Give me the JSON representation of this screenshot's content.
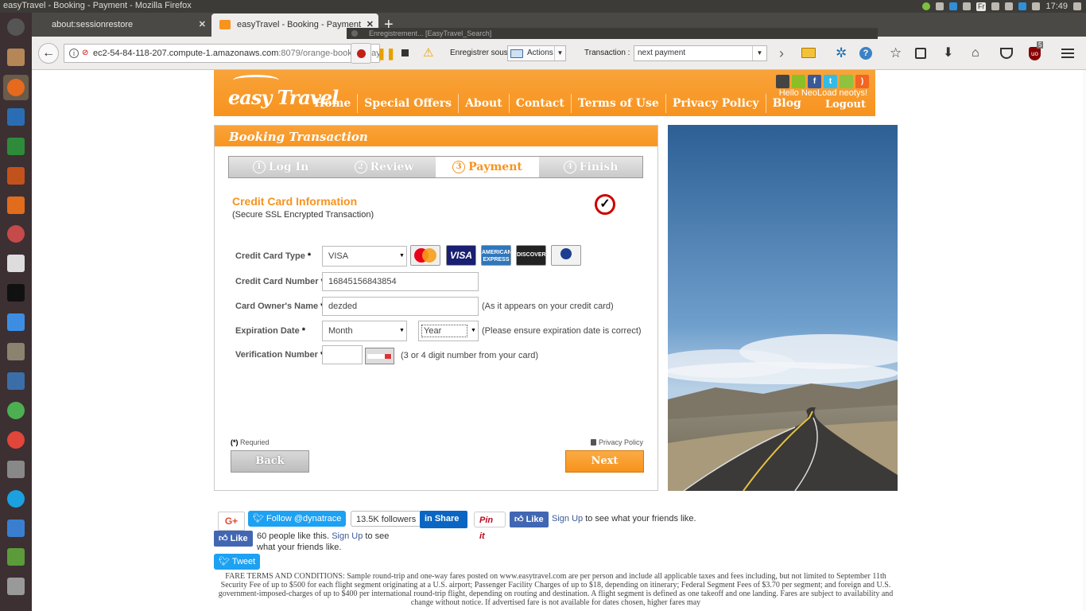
{
  "os_panel": {
    "window_title": "easyTravel - Booking - Payment - Mozilla Firefox",
    "tray_badge": "Fr",
    "clock": "17:49"
  },
  "browser": {
    "tabs": [
      {
        "label": "about:sessionrestore",
        "active": false
      },
      {
        "label": "easyTravel - Booking - Payment",
        "active": true
      }
    ],
    "new_tab": "+",
    "url_host": "ec2-54-84-118-207.compute-1.amazonaws.com",
    "url_rest": ":8079/orange-booking-payme",
    "recorder_title": "Enregistrement... [EasyTravel_Search]",
    "save_label": "Enregistrer sous :",
    "actions_value": "Actions",
    "transaction_label": "Transaction :",
    "transaction_value": "next payment",
    "ublock_count": "5"
  },
  "site": {
    "logo": "easy Travel",
    "nav": [
      "Home",
      "Special Offers",
      "About",
      "Contact",
      "Terms of Use",
      "Privacy Policy",
      "Blog"
    ],
    "greeting": "Hello NeoLoad neotys!",
    "logout": "Logout"
  },
  "booking": {
    "header": "Booking Transaction",
    "steps": [
      {
        "num": "1",
        "label": "Log In"
      },
      {
        "num": "2",
        "label": "Review"
      },
      {
        "num": "3",
        "label": "Payment"
      },
      {
        "num": "4",
        "label": "Finish"
      }
    ],
    "active_step": 2,
    "cc_title": "Credit Card Information",
    "cc_subtitle": "(Secure SSL Encrypted Transaction)",
    "verisign": "VeriSign Secured VERIFY",
    "fields": {
      "card_type": {
        "label": "Credit Card Type",
        "value": "VISA"
      },
      "card_number": {
        "label": "Credit Card Number",
        "value": "16845156843854"
      },
      "owner": {
        "label": "Card Owner's Name",
        "value": "dezded",
        "hint": "(As it appears on your credit card)"
      },
      "expiration": {
        "label": "Expiration Date",
        "month": "Month",
        "year": "Year",
        "hint": "(Please ensure expiration date is correct)"
      },
      "verification": {
        "label": "Verification Number",
        "value": "",
        "hint": "(3 or 4 digit number from your card)"
      }
    },
    "required_mark": "*",
    "cards": [
      {
        "name": "MasterCard",
        "color": "#e8e8e8"
      },
      {
        "name": "VISA",
        "color": "#1a1f71"
      },
      {
        "name": "AMERICAN EXPRESS",
        "color": "#2e77bc"
      },
      {
        "name": "DISCOVER",
        "color": "#222222"
      },
      {
        "name": "Diners Club",
        "color": "#f2f2f2"
      }
    ],
    "required_note_mark": "(*)",
    "required_note": "Requried",
    "privacy": "Privacy Policy",
    "back": "Back",
    "next": "Next"
  },
  "social": {
    "gplus": "G+",
    "follow": "Follow @dynatrace",
    "followers": "13.5K followers",
    "share": "Share",
    "pin": "Pin it",
    "like": "Like",
    "signup": "Sign Up",
    "friends_text": "to see what your friends like.",
    "people_like": "60 people like this.",
    "friends_text2": "to see what your friends like.",
    "tweet": "Tweet"
  },
  "fare_terms": "FARE TERMS AND CONDITIONS: Sample round-trip and one-way fares posted on www.easytravel.com are per person and include all applicable taxes and fees including, but not limited to September 11th Security Fee of up to $500 for each flight segment originating at a U.S. airport; Passenger Facility Charges of up to $18, depending on itinerary; Federal Segment Fees of $3.70 per segment; and foreign and U.S. government-imposed-charges of up to $400 per international round-trip flight, depending on routing and destination. A flight segment is defined as one takeoff and one landing. Fares are subject to availability and change without notice. If advertised fare is not available for dates chosen, higher fares may"
}
